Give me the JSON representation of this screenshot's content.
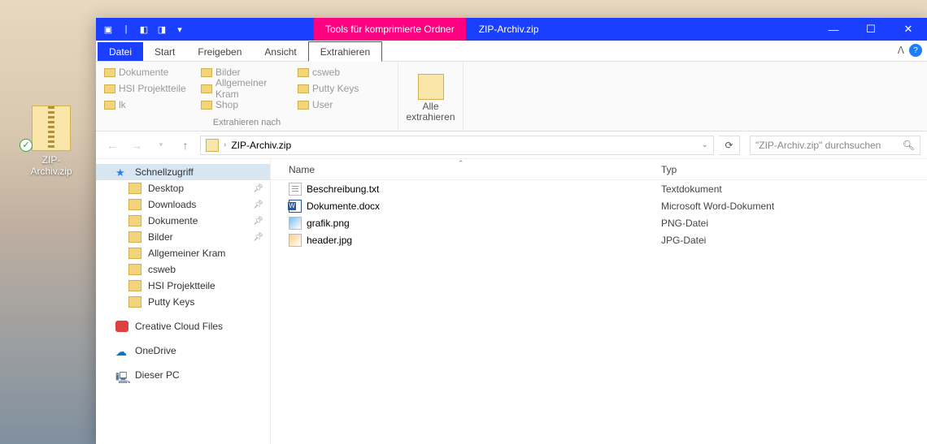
{
  "desktop": {
    "zip_label": "ZIP-Archiv.zip"
  },
  "window": {
    "tool_tab": "Tools für komprimierte Ordner",
    "title": "ZIP-Archiv.zip",
    "tabs": {
      "file": "Datei",
      "start": "Start",
      "share": "Freigeben",
      "view": "Ansicht",
      "extract": "Extrahieren"
    },
    "ribbon": {
      "destinations": [
        [
          "Dokumente",
          "Bilder",
          "csweb"
        ],
        [
          "HSI Projektteile",
          "Allgemeiner Kram",
          "Putty Keys"
        ],
        [
          "lk",
          "Shop",
          "User"
        ]
      ],
      "dest_label": "Extrahieren nach",
      "extract_all": "Alle\nextrahieren"
    },
    "breadcrumb": {
      "current": "ZIP-Archiv.zip"
    },
    "search_placeholder": "\"ZIP-Archiv.zip\" durchsuchen",
    "sidebar": {
      "quick": "Schnellzugriff",
      "pinned": [
        "Desktop",
        "Downloads",
        "Dokumente",
        "Bilder"
      ],
      "recent": [
        "Allgemeiner Kram",
        "csweb",
        "HSI Projektteile",
        "Putty Keys"
      ],
      "cc": "Creative Cloud Files",
      "onedrive": "OneDrive",
      "pc": "Dieser PC"
    },
    "columns": {
      "name": "Name",
      "type": "Typ"
    },
    "files": [
      {
        "name": "Beschreibung.txt",
        "type": "Textdokument",
        "icon": "txt"
      },
      {
        "name": "Dokumente.docx",
        "type": "Microsoft Word-Dokument",
        "icon": "doc"
      },
      {
        "name": "grafik.png",
        "type": "PNG-Datei",
        "icon": "png"
      },
      {
        "name": "header.jpg",
        "type": "JPG-Datei",
        "icon": "jpg"
      }
    ]
  }
}
